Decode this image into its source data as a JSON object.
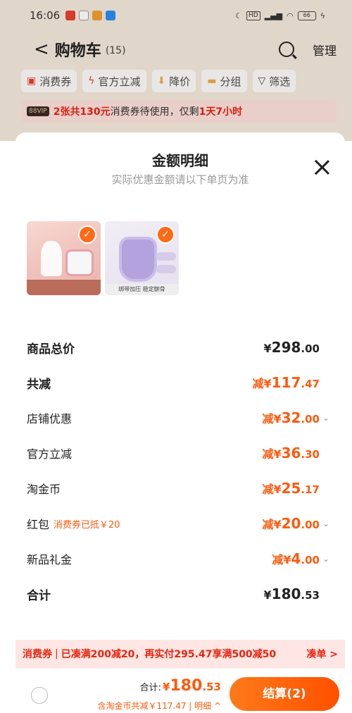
{
  "status": {
    "time": "16:06",
    "battery": "66"
  },
  "nav": {
    "back": "<",
    "title": "购物车",
    "count": "(15)",
    "manage": "管理"
  },
  "filters": [
    {
      "label": "消费券"
    },
    {
      "label": "官方立减"
    },
    {
      "label": "降价"
    },
    {
      "label": "分组"
    },
    {
      "label": "筛选"
    }
  ],
  "vip": {
    "badge": "88VIP",
    "red": "2张共130元",
    "text": "消费券待使用，仅剩",
    "deadline": "1天7小时"
  },
  "sheet": {
    "title": "金额明细",
    "subtitle": "实际优惠金额请以下单页为准",
    "thumb2_caption": "绑带加压 稳定髌骨"
  },
  "rows": [
    {
      "label": "商品总价",
      "prefix": "¥",
      "int": "298",
      "dec": ".00"
    },
    {
      "label": "共减",
      "prefix": "减¥",
      "int": "117",
      "dec": ".47"
    },
    {
      "label": "店铺优惠",
      "prefix": "减¥",
      "int": "32",
      "dec": ".00"
    },
    {
      "label": "官方立减",
      "prefix": "减¥",
      "int": "36",
      "dec": ".30"
    },
    {
      "label": "淘金币",
      "prefix": "减¥",
      "int": "25",
      "dec": ".17"
    },
    {
      "label": "红包",
      "tag": "消费券已抵￥20",
      "prefix": "减¥",
      "int": "20",
      "dec": ".00"
    },
    {
      "label": "新品礼金",
      "prefix": "减¥",
      "int": "4",
      "dec": ".00"
    },
    {
      "label": "合计",
      "prefix": "¥",
      "int": "180",
      "dec": ".53"
    }
  ],
  "promo": {
    "tag": "消费券",
    "sep": "|",
    "text": "已凑满200减20，再实付295.47享满500减50",
    "link": "凑单 >"
  },
  "bottom": {
    "total_label": "合计:",
    "prefix": "¥",
    "int": "180",
    "dec": ".53",
    "subline": "含淘金币共减￥117.47 | 明细 ^",
    "checkout": "结算(2)"
  },
  "colors": {
    "accent": "#ff5a0e",
    "promo_bg": "#fde6e3"
  }
}
